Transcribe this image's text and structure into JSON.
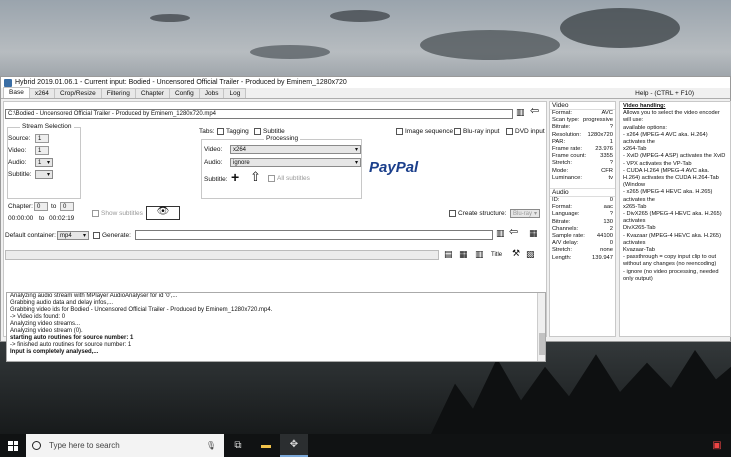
{
  "window": {
    "title": "Hybrid 2019.01.06.1 - Current input: Bodied - Uncensored Official Trailer - Produced by Eminem_1280x720",
    "help": "Help - (CTRL + F10)"
  },
  "tabs": [
    "Base",
    "x264",
    "Crop/Resize",
    "Filtering",
    "Chapter",
    "Config",
    "Jobs",
    "Log"
  ],
  "base": {
    "input_path": "C:\\Bodied - Uncensored Official Trailer - Produced by Eminem_1280x720.mp4",
    "stream_selection": {
      "title": "Stream Selection",
      "source_label": "Source:",
      "source_value": "1",
      "video_label": "Video:",
      "video_value": "1",
      "audio_label": "Audio:",
      "audio_value": "1",
      "subtitle_label": "Subtitle:",
      "chapter_label": "Chapter:",
      "chapter_from": "0",
      "chapter_to_label": "to",
      "chapter_to": "0",
      "time_from": "00:00:00",
      "time_to_label": "to",
      "time_to": "00:02:19",
      "show_subtitles": "Show subtitles"
    },
    "tabs_row": {
      "label": "Tabs:",
      "tagging": "Tagging",
      "subtitle": "Subtitle",
      "image_sequence": "Image sequence",
      "bluray_input": "Blu-ray input",
      "dvd_input": "DVD input"
    },
    "processing": {
      "title": "Processing",
      "video_label": "Video:",
      "video_value": "x264",
      "audio_label": "Audio:",
      "audio_value": "ignore",
      "subtitle_label": "Subtitle:",
      "all_subtitles": "All subtitles"
    },
    "paypal": "PayPal",
    "create_structure": "Create structure:",
    "structure_value": "Blu-ray",
    "default_container_label": "Default container:",
    "container_value": "mp4",
    "generate": "Generate:",
    "title_label": "Title"
  },
  "video_info": {
    "title": "Video",
    "rows": [
      [
        "Format:",
        "AVC"
      ],
      [
        "Scan type:",
        "progressive"
      ],
      [
        "Bitrate:",
        "?"
      ],
      [
        "Resolution:",
        "1280x720"
      ],
      [
        "PAR:",
        "1"
      ],
      [
        "Frame rate:",
        "23.976"
      ],
      [
        "Frame count:",
        "3355"
      ],
      [
        "Stretch:",
        "?"
      ],
      [
        "Mode:",
        "CFR"
      ],
      [
        "Luminance:",
        "tv"
      ]
    ]
  },
  "audio_info": {
    "title": "Audio",
    "rows": [
      [
        "ID:",
        "0"
      ],
      [
        "Format:",
        "aac"
      ],
      [
        "Language:",
        "?"
      ],
      [
        "Bitrate:",
        "130"
      ],
      [
        "Channels:",
        "2"
      ],
      [
        "Sample rate:",
        "44100"
      ],
      [
        "A/V delay:",
        "0"
      ],
      [
        "Stretch:",
        "none"
      ],
      [
        "Length:",
        "139.947"
      ]
    ]
  },
  "help_text": {
    "heading": "Video handling:",
    "lines": [
      "Allows you to select the video encoder",
      "will use:",
      "available options:",
      "- x264 (MPEG-4 AVC aka. H.264) activates the",
      "x264-Tab",
      "- XviD (MPEG-4 ASP) activates the XviD",
      "- VPX activates the VP-Tab",
      "- CUDA H.264 (MPEG-4 AVC aka. H.264) activates the CUDA H.264-Tab (Window",
      "- x265 (MPEG-4 HEVC aka. H.265) activates the",
      "x265-Tab",
      "- DivX265 (MPEG-4 HEVC aka. H.265) activates",
      "DivX265-Tab",
      "- Kvazaar (MPEG-4 HEVC aka. H.265) activates",
      "Kvazaar-Tab",
      "- passthrough = copy input clip to out",
      "without any changes (no reencoding)",
      "- ignore (no video processing, needed",
      "only output)"
    ]
  },
  "log": [
    {
      "text": "Analyzing audio stream with MPlayer AudioAnalyser for id '0',...",
      "bold": false
    },
    {
      "text": "Grabbing audio data and delay infos,...",
      "bold": false
    },
    {
      "text": "Grabbing video ids for Bodied - Uncensored Official Trailer - Produced by Eminem_1280x720.mp4.",
      "bold": false
    },
    {
      "text": "-> Video ids found: 0",
      "bold": false
    },
    {
      "text": "Analyzing video streams...",
      "bold": false
    },
    {
      "text": "Analyzing video stream (0).",
      "bold": false
    },
    {
      "text": "starting auto routines for source number: 1",
      "bold": true
    },
    {
      "text": "-> finished auto routines for source number: 1",
      "bold": false
    },
    {
      "text": "Input is completely analysed,...",
      "bold": true
    }
  ],
  "taskbar": {
    "search_placeholder": "Type here to search"
  }
}
